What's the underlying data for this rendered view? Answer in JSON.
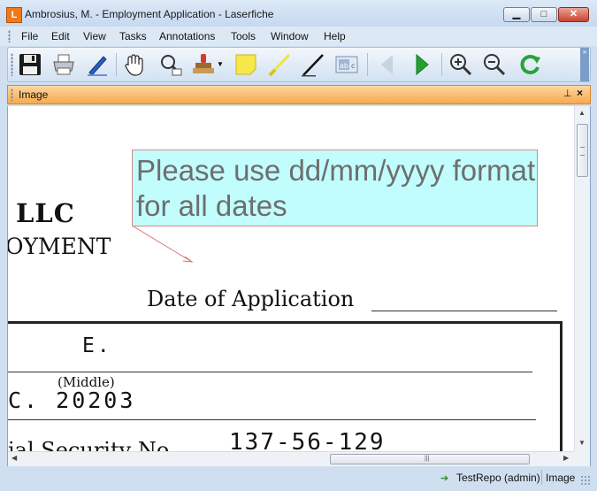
{
  "window": {
    "title": "Ambrosius, M. - Employment Application - Laserfiche",
    "app_icon_letter": "L"
  },
  "menu": [
    "File",
    "Edit",
    "View",
    "Tasks",
    "Annotations",
    "Tools",
    "Window",
    "Help"
  ],
  "toolbar": {
    "tools": [
      "save-icon",
      "print-icon",
      "scan-pen-icon",
      "pan-hand-icon",
      "zoom-select-icon",
      "stamp-icon",
      "sticky-note-icon",
      "highlighter-icon",
      "pen-icon",
      "text-box-icon",
      "back-arrow-icon",
      "forward-arrow-icon",
      "zoom-in-icon",
      "zoom-out-icon",
      "refresh-icon"
    ],
    "overflow": "»"
  },
  "pane": {
    "title": "Image",
    "pin": "⊥",
    "close": "×"
  },
  "document": {
    "company_fragment": "LLC",
    "heading_fragment": "OYMENT",
    "date_label": "Date of Application",
    "field_initial": "E.",
    "middle_label": "(Middle)",
    "zip_value": "C. 20203",
    "ssn_label_fragment": "ial Security No.",
    "ssn_value": "137-56-129"
  },
  "annotation": {
    "sticky_text": "Please use dd/mm/yyyy format for all dates",
    "fill_color": "#c1fdfc",
    "border_color": "#d38a86"
  },
  "status": {
    "repository": "TestRepo (admin)",
    "view_mode": "Image"
  }
}
